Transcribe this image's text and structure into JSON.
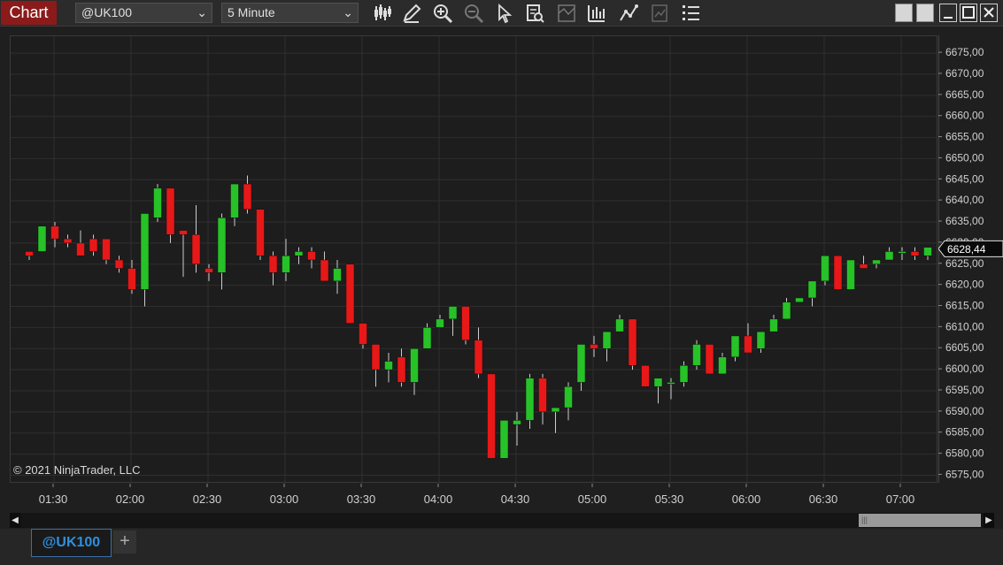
{
  "window": {
    "title": "Chart",
    "instrument": "@UK100",
    "period": "5 Minute",
    "accent": "#8b1a1a"
  },
  "toolbar_icons": [
    "bar-type-icon",
    "drawing-tool-icon",
    "zoom-in-icon",
    "zoom-out-icon",
    "pointer-icon",
    "properties-icon",
    "indicators-icon",
    "data-box-icon",
    "strategies-icon",
    "templates-icon",
    "list-icon"
  ],
  "colors": {
    "up": "#27c227",
    "down": "#e81818",
    "grid": "#2f2f2f",
    "wick": "#cccccc"
  },
  "chart_data": {
    "type": "candlestick",
    "xlabel": "",
    "ylabel": "",
    "ylim": [
      6573,
      6679
    ],
    "x_ticks": [
      "01:30",
      "02:00",
      "02:30",
      "03:00",
      "03:30",
      "04:00",
      "04:30",
      "05:00",
      "05:30",
      "06:00",
      "06:30",
      "07:00"
    ],
    "y_ticks": [
      "6575,00",
      "6580,00",
      "6585,00",
      "6590,00",
      "6595,00",
      "6600,00",
      "6605,00",
      "6610,00",
      "6615,00",
      "6620,00",
      "6625,00",
      "6630,00",
      "6635,00",
      "6640,00",
      "6645,00",
      "6650,00",
      "6655,00",
      "6660,00",
      "6665,00",
      "6670,00",
      "6675,00"
    ],
    "last_price_label": "6628,44",
    "candles": [
      [
        6628,
        6628,
        6626,
        6627
      ],
      [
        6628,
        6634,
        6628,
        6634
      ],
      [
        6634,
        6635,
        6629,
        6631
      ],
      [
        6631,
        6632,
        6629,
        6630
      ],
      [
        6630,
        6633,
        6628,
        6627
      ],
      [
        6631,
        6632,
        6627,
        6628
      ],
      [
        6631,
        6631,
        6625,
        6626
      ],
      [
        6626,
        6627,
        6623,
        6624
      ],
      [
        6624,
        6626,
        6618,
        6619
      ],
      [
        6619,
        6637,
        6615,
        6637
      ],
      [
        6636,
        6644,
        6635,
        6643
      ],
      [
        6643,
        6643,
        6630,
        6632
      ],
      [
        6633,
        6633,
        6622,
        6632
      ],
      [
        6632,
        6639,
        6623,
        6625
      ],
      [
        6624,
        6625,
        6621,
        6623
      ],
      [
        6623,
        6637,
        6619,
        6636
      ],
      [
        6636,
        6644,
        6634,
        6644
      ],
      [
        6644,
        6646,
        6637,
        6638
      ],
      [
        6638,
        6638,
        6626,
        6627
      ],
      [
        6627,
        6628,
        6620,
        6623
      ],
      [
        6623,
        6631,
        6621,
        6627
      ],
      [
        6627,
        6629,
        6625,
        6628
      ],
      [
        6628,
        6629,
        6624,
        6626
      ],
      [
        6626,
        6628,
        6621,
        6621
      ],
      [
        6621,
        6626,
        6618,
        6624
      ],
      [
        6625,
        6625,
        6611,
        6611
      ],
      [
        6611,
        6611,
        6605,
        6606
      ],
      [
        6606,
        6606,
        6596,
        6600
      ],
      [
        6600,
        6604,
        6597,
        6602
      ],
      [
        6603,
        6605,
        6596,
        6597
      ],
      [
        6597,
        6605,
        6594,
        6605
      ],
      [
        6605,
        6611,
        6605,
        6610
      ],
      [
        6610,
        6613,
        6610,
        6612
      ],
      [
        6612,
        6615,
        6608,
        6615
      ],
      [
        6615,
        6615,
        6606,
        6607
      ],
      [
        6607,
        6610,
        6598,
        6599
      ],
      [
        6599,
        6599,
        6579,
        6579
      ],
      [
        6579,
        6588,
        6579,
        6588
      ],
      [
        6587,
        6590,
        6582,
        6588
      ],
      [
        6588,
        6599,
        6586,
        6598
      ],
      [
        6598,
        6599,
        6587,
        6590
      ],
      [
        6590,
        6591,
        6585,
        6591
      ],
      [
        6591,
        6597,
        6588,
        6596
      ],
      [
        6597,
        6606,
        6595,
        6606
      ],
      [
        6606,
        6608,
        6603,
        6605
      ],
      [
        6605,
        6609,
        6602,
        6609
      ],
      [
        6609,
        6613,
        6609,
        6612
      ],
      [
        6612,
        6612,
        6600,
        6601
      ],
      [
        6601,
        6601,
        6596,
        6596
      ],
      [
        6596,
        6598,
        6592,
        6598
      ],
      [
        6597,
        6598,
        6593,
        6597
      ],
      [
        6597,
        6602,
        6596,
        6601
      ],
      [
        6601,
        6607,
        6600,
        6606
      ],
      [
        6606,
        6606,
        6599,
        6599
      ],
      [
        6599,
        6604,
        6599,
        6603
      ],
      [
        6603,
        6608,
        6602,
        6608
      ],
      [
        6608,
        6611,
        6604,
        6604
      ],
      [
        6605,
        6609,
        6604,
        6609
      ],
      [
        6609,
        6613,
        6609,
        6612
      ],
      [
        6612,
        6617,
        6612,
        6616
      ],
      [
        6616,
        6617,
        6616,
        6617
      ],
      [
        6617,
        6620,
        6615,
        6621
      ],
      [
        6621,
        6627,
        6620,
        6627
      ],
      [
        6627,
        6627,
        6619,
        6619
      ],
      [
        6619,
        6626,
        6619,
        6626
      ],
      [
        6625,
        6627,
        6624,
        6624
      ],
      [
        6625,
        6626,
        6624,
        6626
      ],
      [
        6626,
        6629,
        6626,
        6628
      ],
      [
        6628,
        6629,
        6626,
        6628
      ],
      [
        6628,
        6629,
        6626,
        6627
      ],
      [
        6627,
        6629,
        6626,
        6629
      ]
    ]
  },
  "footer": {
    "copyright": "© 2021 NinjaTrader, LLC"
  },
  "tabs": [
    {
      "label": "@UK100"
    }
  ],
  "add_tab_label": "+"
}
